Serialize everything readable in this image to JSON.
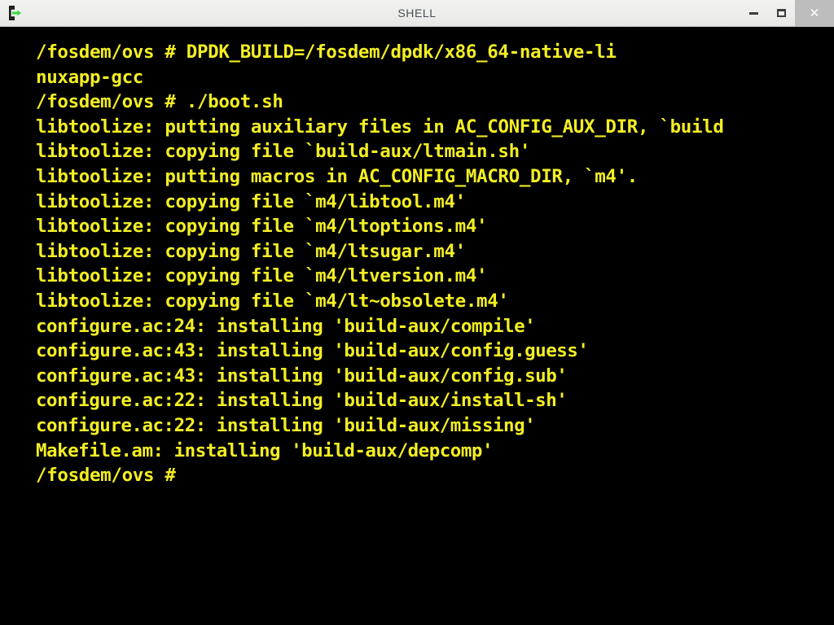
{
  "window": {
    "title": "SHELL",
    "icon": "terminal-icon",
    "controls": {
      "minimize_label": "–",
      "maximize_label": "□",
      "close_label": "✕"
    },
    "titlebar_bg": "#ededeb",
    "title_color": "#4a4f57",
    "close_button_bg": "#bdbdbd"
  },
  "terminal": {
    "background": "#000000",
    "foreground": "#f2ee23",
    "prompt": "/fosdem/ovs #",
    "cursor_visible": false,
    "lines": [
      {
        "text": "/fosdem/ovs # DPDK_BUILD=/fosdem/dpdk/x86_64-native-li",
        "style": "bold"
      },
      {
        "text": "nuxapp-gcc",
        "style": "bold"
      },
      {
        "text": "/fosdem/ovs # ./boot.sh",
        "style": "bold"
      },
      {
        "text": "libtoolize: putting auxiliary files in AC_CONFIG_AUX_DIR, `build",
        "style": "bold"
      },
      {
        "text": "libtoolize: copying file `build-aux/ltmain.sh'",
        "style": "bold"
      },
      {
        "text": "libtoolize: putting macros in AC_CONFIG_MACRO_DIR, `m4'.",
        "style": "bold"
      },
      {
        "text": "libtoolize: copying file `m4/libtool.m4'",
        "style": "bold"
      },
      {
        "text": "libtoolize: copying file `m4/ltoptions.m4'",
        "style": "bold"
      },
      {
        "text": "libtoolize: copying file `m4/ltsugar.m4'",
        "style": "bold"
      },
      {
        "text": "libtoolize: copying file `m4/ltversion.m4'",
        "style": "bold"
      },
      {
        "text": "libtoolize: copying file `m4/lt~obsolete.m4'",
        "style": "bold"
      },
      {
        "text": "configure.ac:24: installing 'build-aux/compile'",
        "style": "light"
      },
      {
        "text": "configure.ac:43: installing 'build-aux/config.guess'",
        "style": "light"
      },
      {
        "text": "configure.ac:43: installing 'build-aux/config.sub'",
        "style": "light"
      },
      {
        "text": "configure.ac:22: installing 'build-aux/install-sh'",
        "style": "light"
      },
      {
        "text": "configure.ac:22: installing 'build-aux/missing'",
        "style": "light"
      },
      {
        "text": "Makefile.am: installing 'build-aux/depcomp'",
        "style": "light"
      },
      {
        "text": "/fosdem/ovs # ",
        "style": "bold"
      }
    ]
  }
}
